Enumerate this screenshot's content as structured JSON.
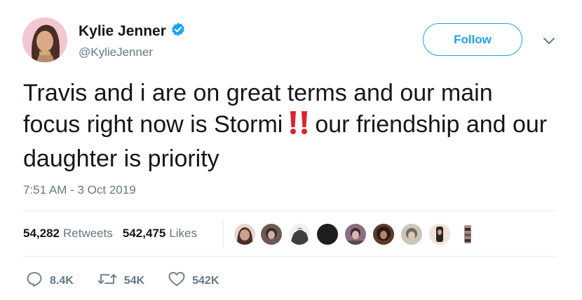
{
  "author": {
    "display_name": "Kylie Jenner",
    "handle": "@KylieJenner",
    "verified": true
  },
  "follow_button": {
    "label": "Follow"
  },
  "tweet": {
    "text_before_emoji": "Travis and i are on great terms and our main focus right now is Stormi",
    "emoji": "double-exclamation-mark",
    "text_after_emoji": "our friendship and our daughter is priority",
    "timestamp": "7:51 AM - 3 Oct 2019"
  },
  "stats": {
    "retweets_count": "54,282",
    "retweets_label": "Retweets",
    "likes_count": "542,475",
    "likes_label": "Likes"
  },
  "likers": [
    {
      "icon": "liker-avatar-1",
      "color": "#c9a28f"
    },
    {
      "icon": "liker-avatar-2",
      "color": "#6b5a55"
    },
    {
      "icon": "liker-avatar-3",
      "color": "#3e3e3e"
    },
    {
      "icon": "liker-avatar-4",
      "color": "#1e1e1e"
    },
    {
      "icon": "liker-avatar-5",
      "color": "#8b6f80"
    },
    {
      "icon": "liker-avatar-6",
      "color": "#5a3b2c"
    },
    {
      "icon": "liker-avatar-7",
      "color": "#9a9a8c"
    },
    {
      "icon": "liker-avatar-8",
      "color": "#d9cfc0"
    },
    {
      "icon": "liker-avatar-9",
      "color": "#a88a86"
    }
  ],
  "actions": {
    "reply_count": "8.4K",
    "retweet_count": "54K",
    "like_count": "542K"
  },
  "colors": {
    "accent": "#1da1f2",
    "muted": "#657786",
    "emoji_red": "#d9252b"
  }
}
